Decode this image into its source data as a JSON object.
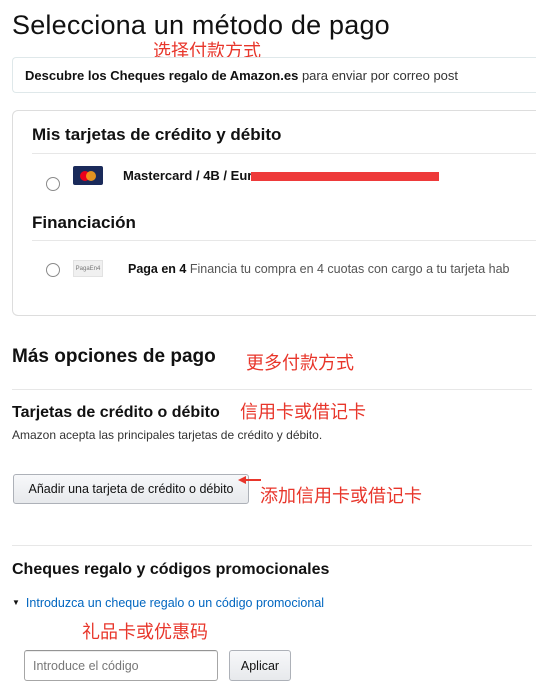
{
  "page": {
    "title": "Selecciona un método de pago"
  },
  "annotations": {
    "choose_payment": "选择付款方式",
    "more_methods": "更多付款方式",
    "credit_debit": "信用卡或借记卡",
    "add_card": "添加信用卡或借记卡",
    "gift_promo": "礼品卡或优惠码"
  },
  "banner": {
    "bold": "Descubre los Cheques regalo de Amazon.es",
    "rest": " para enviar por correo post"
  },
  "saved_methods": {
    "cards_heading": "Mis tarjetas de crédito y débito",
    "card": {
      "icon": "mastercard-icon",
      "text": "Mastercard / 4B / Eur"
    },
    "financing_heading": "Financiación",
    "financing": {
      "icon": "paga-en-4-icon",
      "logo_text": "PagaEn4",
      "title": "Paga en 4",
      "description": " Financia tu compra en 4 cuotas con cargo a tu tarjeta hab"
    }
  },
  "more_options": {
    "heading": "Más opciones de pago",
    "cards_subheading": "Tarjetas de crédito o débito",
    "cards_note": "Amazon acepta las principales tarjetas de crédito y débito.",
    "add_card_button": "Añadir una tarjeta de crédito o débito"
  },
  "gift": {
    "heading": "Cheques regalo y códigos promocionales",
    "link": "Introduzca un cheque regalo o un código promocional",
    "input_placeholder": "Introduce el código",
    "apply_button": "Aplicar"
  },
  "colors": {
    "annotation": "#e8362b",
    "link": "#0066c0",
    "redaction": "#ee3a3a"
  }
}
